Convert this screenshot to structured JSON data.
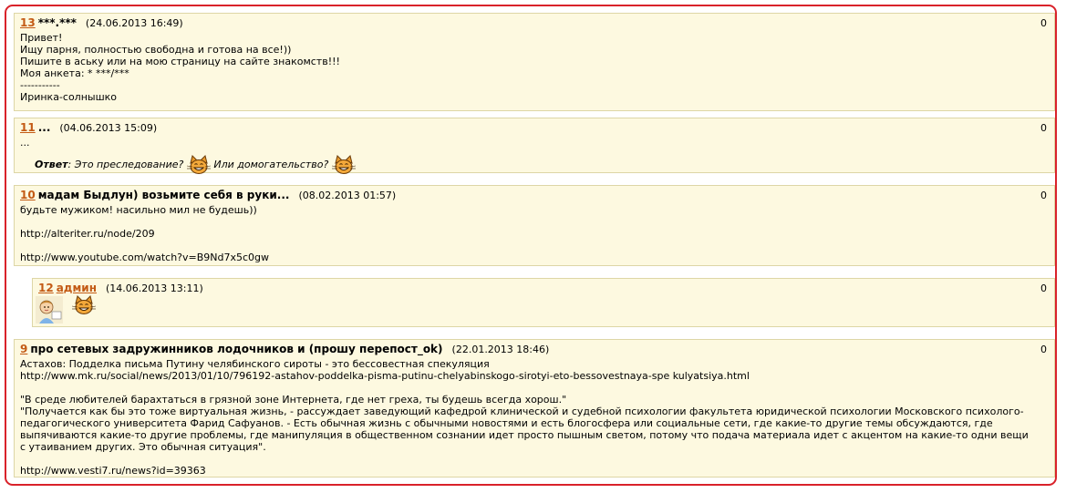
{
  "comments": [
    {
      "number": "13",
      "title": "***.***",
      "date": "(24.06.2013 16:49)",
      "score": "0",
      "body": "Привет!\nИщу парня, полностью свободна и готова на все!))\nПишите в аську или на мою страницу на сайте знакомств!!!\nМоя анкета: * ***/***\n-----------\nИринка-солнышко"
    },
    {
      "number": "11",
      "title": "...",
      "date": "(04.06.2013 15:09)",
      "score": "0",
      "body": "...",
      "reply_label": "Ответ",
      "reply_part1": ": Это преследование?",
      "reply_part2": "Или домогательство?"
    },
    {
      "number": "10",
      "title": "мадам Быдлун) возьмите себя в руки...",
      "date": "(08.02.2013 01:57)",
      "score": "0",
      "body": "будьте мужиком! насильно мил не будешь))\n\nhttp://alteriter.ru/node/209\n\nhttp://www.youtube.com/watch?v=B9Nd7x5c0gw"
    },
    {
      "number": "12",
      "author": "админ",
      "date": "(14.06.2013 13:11)",
      "score": "0"
    },
    {
      "number": "9",
      "title": "про сетевых задружинников лодочников и (прошу перепост_ok)",
      "date": "(22.01.2013 18:46)",
      "score": "0",
      "body": "Астахов: Подделка письма Путину челябинского сироты - это бессовестная спекуляция\nhttp://www.mk.ru/social/news/2013/01/10/796192-astahov-poddelka-pisma-putinu-chelyabinskogo-sirotyi-eto-bessovestnaya-spe kulyatsiya.html\n\n\"В среде любителей барахтаться в грязной зоне Интернета, где нет греха, ты будешь всегда хорош.\"\n\"Получается как бы это тоже виртуальная жизнь, - рассуждает заведующий кафедрой клинической и судебной психологии факультета юридической психологии Московского психолого-педагогического университета Фарид Сафуанов. - Есть обычная жизнь с обычными новостями и есть блогосфера или социальные сети, где какие-то другие темы обсуждаются, где выпячиваются какие-то другие проблемы, где манипуляция в общественном сознании идет просто пышным светом, потому что подача материала идет с акцентом на какие-то одни вещи с утаиванием других. Это обычная ситуация\".\n\nhttp://www.vesti7.ru/news?id=39363"
    }
  ],
  "icons": {
    "emoticon": "cat-grin-icon",
    "avatar": "user-avatar-image"
  },
  "colors": {
    "frame": "#d9222a",
    "comment_bg": "#fdf9e0",
    "comment_border": "#ddd6a6",
    "link": "#c35a14"
  }
}
